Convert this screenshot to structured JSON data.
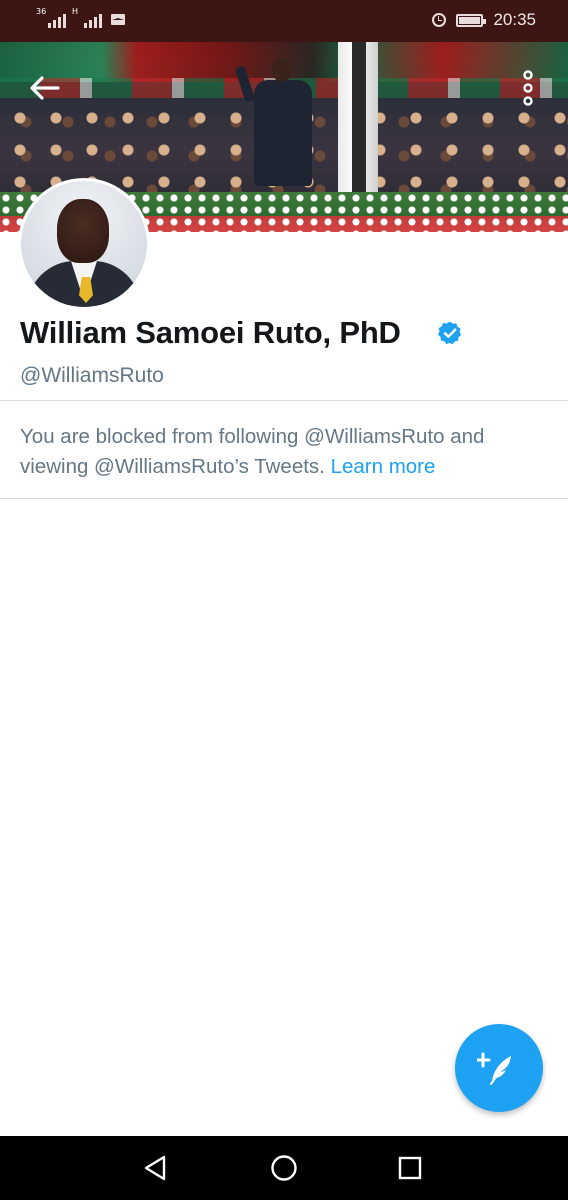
{
  "status_bar": {
    "signal_1_label": "36",
    "signal_2_label": "H",
    "time": "20:35",
    "icons": [
      "signal-icon",
      "signal-icon",
      "mail-icon",
      "alarm-icon",
      "battery-icon"
    ]
  },
  "header": {
    "icons": [
      "back-arrow-icon",
      "more-vertical-icon"
    ]
  },
  "profile": {
    "display_name": "William Samoei Ruto, PhD",
    "handle": "@WilliamsRuto",
    "verified": true
  },
  "blocked_notice": {
    "text": "You are blocked from following @WilliamsRuto and viewing @WilliamsRuto’s Tweets.",
    "link_label": "Learn more"
  },
  "fab": {
    "icon": "compose-tweet-icon"
  },
  "nav_bar": {
    "icons": [
      "back-triangle-icon",
      "home-circle-icon",
      "recents-square-icon"
    ]
  },
  "colors": {
    "accent": "#1da1f2",
    "status_bar_bg": "#3d1512",
    "name_text": "#14171a",
    "secondary_text": "#657786"
  }
}
